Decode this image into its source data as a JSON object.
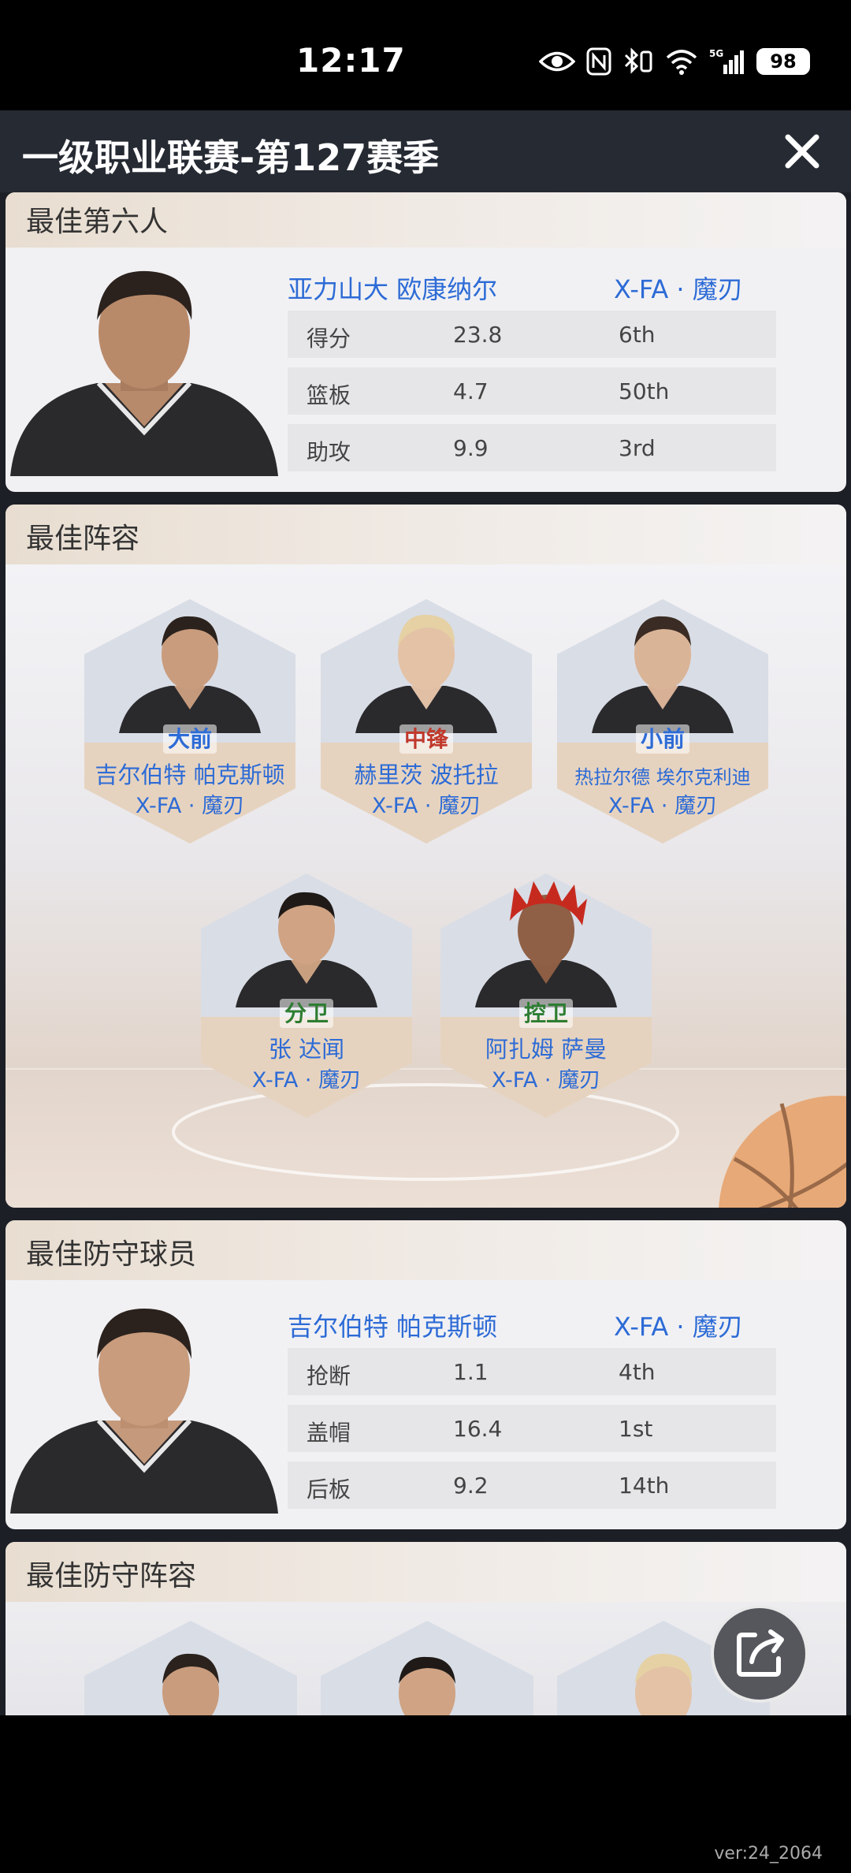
{
  "status": {
    "time": "12:17",
    "battery": "98",
    "network": "5G"
  },
  "header": {
    "title": "一级职业联赛-第127赛季"
  },
  "sixth_man": {
    "section_title": "最佳第六人",
    "player_name": "亚力山大 欧康纳尔",
    "team": "X-FA · 魔刃",
    "stats": [
      {
        "label": "得分",
        "value": "23.8",
        "rank": "6th"
      },
      {
        "label": "篮板",
        "value": "4.7",
        "rank": "50th"
      },
      {
        "label": "助攻",
        "value": "9.9",
        "rank": "3rd"
      }
    ]
  },
  "all_league": {
    "section_title": "最佳阵容",
    "players": [
      {
        "position": "大前",
        "name": "吉尔伯特 帕克斯顿",
        "team": "X-FA · 魔刃"
      },
      {
        "position": "中锋",
        "name": "赫里茨 波托拉",
        "team": "X-FA · 魔刃"
      },
      {
        "position": "小前",
        "name": "热拉尔德 埃尔克利迪",
        "team": "X-FA · 魔刃"
      },
      {
        "position": "分卫",
        "name": "张 达闻",
        "team": "X-FA · 魔刃"
      },
      {
        "position": "控卫",
        "name": "阿扎姆 萨曼",
        "team": "X-FA · 魔刃"
      }
    ]
  },
  "defensive_player": {
    "section_title": "最佳防守球员",
    "player_name": "吉尔伯特 帕克斯顿",
    "team": "X-FA · 魔刃",
    "stats": [
      {
        "label": "抢断",
        "value": "1.1",
        "rank": "4th"
      },
      {
        "label": "盖帽",
        "value": "16.4",
        "rank": "1st"
      },
      {
        "label": "后板",
        "value": "9.2",
        "rank": "14th"
      }
    ]
  },
  "all_defense": {
    "section_title": "最佳防守阵容"
  },
  "share": {
    "label": "分享"
  },
  "version": "ver:24_2064",
  "colors": {
    "accent_blue": "#2d6bd6",
    "title_bar": "#262a33",
    "card_bg": "#f1f1f4",
    "hex_bottom": "#e6d3bf"
  }
}
